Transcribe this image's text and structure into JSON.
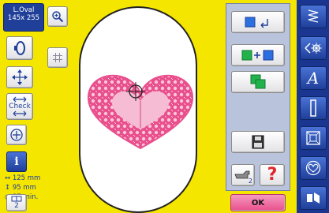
{
  "hoop": {
    "name": "L.Oval",
    "size": "145x 255"
  },
  "info": {
    "width": "125 mm",
    "height": "95 mm",
    "time": "37 min."
  },
  "buttons": {
    "check_label": "Check",
    "help_label": "?",
    "ok_label": "OK",
    "multi_count": "2",
    "left_bottom_count": "2",
    "info_label": "i"
  },
  "colors": {
    "background": "#f5e600",
    "accent_blue": "#1b3690",
    "design_pink": "#e94f8c",
    "help_red": "#e0262c",
    "ok_pink": "#e94f8c"
  },
  "icons": [
    "zoom-icon",
    "hoop-select-icon",
    "grid-icon",
    "move-icon",
    "center-icon",
    "info-icon",
    "rotate-icon",
    "combine-icon",
    "layers-icon",
    "save-icon",
    "multi-hand-icon",
    "stitch-pattern-icon",
    "embroidery-icon",
    "alphabet-icon",
    "buttonhole-icon",
    "quilt-icon",
    "heart-icon",
    "personal-program-icon",
    "rewind-icon"
  ]
}
